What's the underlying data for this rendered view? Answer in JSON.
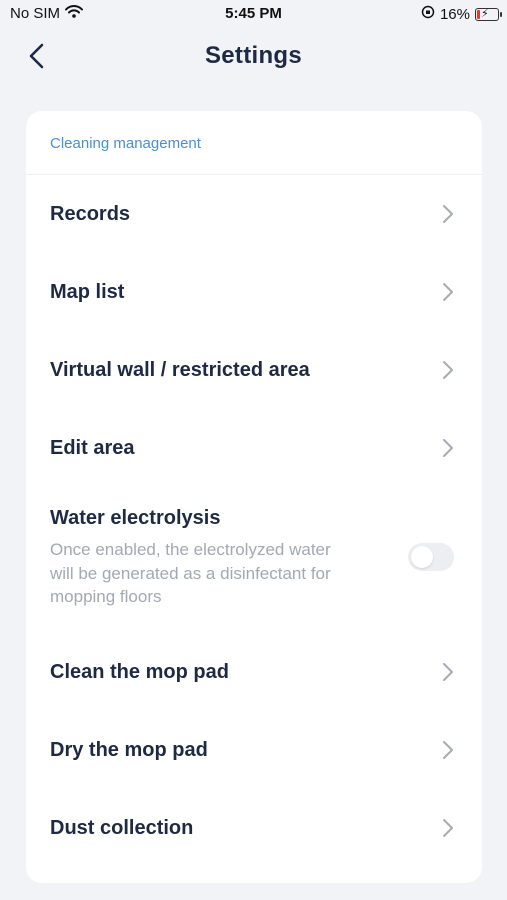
{
  "status_bar": {
    "carrier": "No SIM",
    "time": "5:45 PM",
    "battery_percent": "16%"
  },
  "nav": {
    "title": "Settings",
    "icons": {
      "back": "chevron-left-icon"
    }
  },
  "section": {
    "title": "Cleaning management"
  },
  "rows": {
    "records": "Records",
    "map_list": "Map list",
    "virtual_wall": "Virtual wall / restricted area",
    "edit_area": "Edit area",
    "water_electrolysis": {
      "label": "Water electrolysis",
      "description": "Once enabled, the electrolyzed water will be generated as a disinfectant for mopping floors",
      "enabled": false
    },
    "clean_mop_pad": "Clean the mop pad",
    "dry_mop_pad": "Dry the mop pad",
    "dust_collection": "Dust collection"
  },
  "colors": {
    "background": "#f2f3f7",
    "card": "#ffffff",
    "section_title": "#4a8fd6",
    "label": "#1e2a44",
    "description": "#a3a8b3",
    "chevron": "#a6abb5"
  }
}
